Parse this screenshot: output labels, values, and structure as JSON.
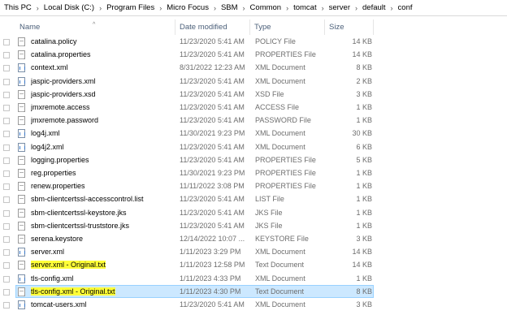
{
  "breadcrumb": [
    "This PC",
    "Local Disk (C:)",
    "Program Files",
    "Micro Focus",
    "SBM",
    "Common",
    "tomcat",
    "server",
    "default",
    "conf"
  ],
  "breadcrumb_separator": "›",
  "columns": {
    "name": "Name",
    "date": "Date modified",
    "type": "Type",
    "size": "Size"
  },
  "sort_indicator": "^",
  "files": [
    {
      "name": "catalina.policy",
      "date": "11/23/2020 5:41 AM",
      "type": "POLICY File",
      "size": "14 KB",
      "icon": "file-icon"
    },
    {
      "name": "catalina.properties",
      "date": "11/23/2020 5:41 AM",
      "type": "PROPERTIES File",
      "size": "14 KB",
      "icon": "file-icon"
    },
    {
      "name": "context.xml",
      "date": "8/31/2022 12:23 AM",
      "type": "XML Document",
      "size": "8 KB",
      "icon": "xml-icon"
    },
    {
      "name": "jaspic-providers.xml",
      "date": "11/23/2020 5:41 AM",
      "type": "XML Document",
      "size": "2 KB",
      "icon": "xml-icon"
    },
    {
      "name": "jaspic-providers.xsd",
      "date": "11/23/2020 5:41 AM",
      "type": "XSD File",
      "size": "3 KB",
      "icon": "file-icon"
    },
    {
      "name": "jmxremote.access",
      "date": "11/23/2020 5:41 AM",
      "type": "ACCESS File",
      "size": "1 KB",
      "icon": "file-icon"
    },
    {
      "name": "jmxremote.password",
      "date": "11/23/2020 5:41 AM",
      "type": "PASSWORD File",
      "size": "1 KB",
      "icon": "file-icon"
    },
    {
      "name": "log4j.xml",
      "date": "11/30/2021 9:23 PM",
      "type": "XML Document",
      "size": "30 KB",
      "icon": "xml-icon"
    },
    {
      "name": "log4j2.xml",
      "date": "11/23/2020 5:41 AM",
      "type": "XML Document",
      "size": "6 KB",
      "icon": "xml-icon"
    },
    {
      "name": "logging.properties",
      "date": "11/23/2020 5:41 AM",
      "type": "PROPERTIES File",
      "size": "5 KB",
      "icon": "file-icon"
    },
    {
      "name": "reg.properties",
      "date": "11/30/2021 9:23 PM",
      "type": "PROPERTIES File",
      "size": "1 KB",
      "icon": "file-icon"
    },
    {
      "name": "renew.properties",
      "date": "11/11/2022 3:08 PM",
      "type": "PROPERTIES File",
      "size": "1 KB",
      "icon": "file-icon"
    },
    {
      "name": "sbm-clientcertssl-accesscontrol.list",
      "date": "11/23/2020 5:41 AM",
      "type": "LIST File",
      "size": "1 KB",
      "icon": "file-icon"
    },
    {
      "name": "sbm-clientcertssl-keystore.jks",
      "date": "11/23/2020 5:41 AM",
      "type": "JKS File",
      "size": "1 KB",
      "icon": "file-icon"
    },
    {
      "name": "sbm-clientcertssl-truststore.jks",
      "date": "11/23/2020 5:41 AM",
      "type": "JKS File",
      "size": "1 KB",
      "icon": "file-icon"
    },
    {
      "name": "serena.keystore",
      "date": "12/14/2022 10:07 ...",
      "type": "KEYSTORE File",
      "size": "3 KB",
      "icon": "file-icon"
    },
    {
      "name": "server.xml",
      "date": "1/11/2023 3:29 PM",
      "type": "XML Document",
      "size": "14 KB",
      "icon": "xml-icon"
    },
    {
      "name": "server.xml - Original.txt",
      "date": "1/11/2023 12:58 PM",
      "type": "Text Document",
      "size": "14 KB",
      "icon": "text-file-icon",
      "highlighted": true
    },
    {
      "name": "tls-config.xml",
      "date": "1/11/2023 4:33 PM",
      "type": "XML Document",
      "size": "1 KB",
      "icon": "xml-icon"
    },
    {
      "name": "tls-config.xml - Original.txt",
      "date": "1/11/2023 4:30 PM",
      "type": "Text Document",
      "size": "8 KB",
      "icon": "text-file-icon",
      "highlighted": true,
      "selected": true
    },
    {
      "name": "tomcat-users.xml",
      "date": "11/23/2020 5:41 AM",
      "type": "XML Document",
      "size": "3 KB",
      "icon": "xml-icon"
    }
  ],
  "colors": {
    "selection": "#cce8ff",
    "highlight": "#ffff38",
    "header_text": "#4c607a"
  }
}
